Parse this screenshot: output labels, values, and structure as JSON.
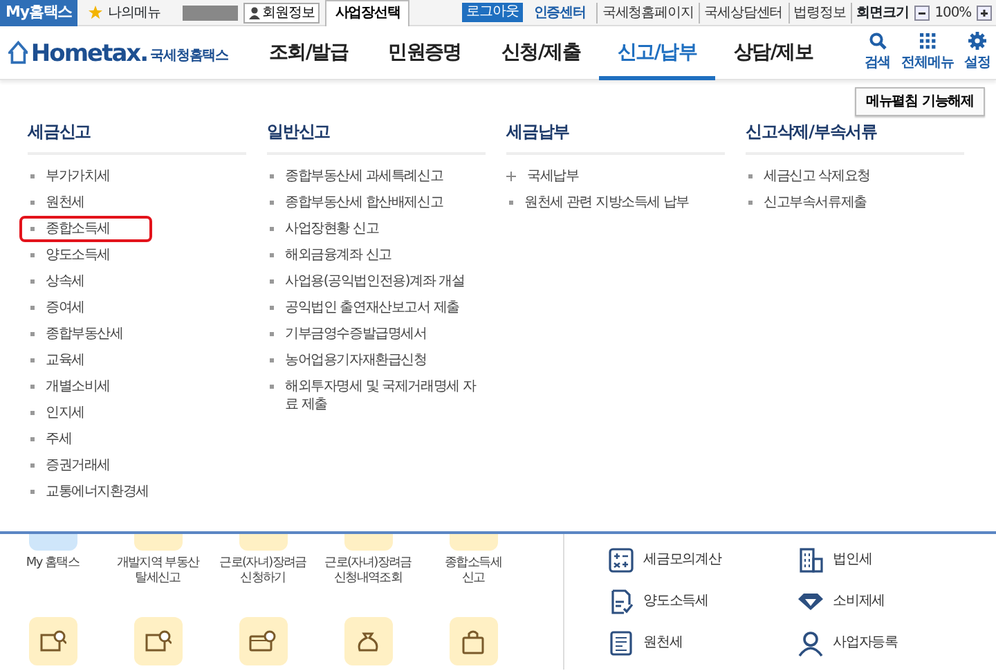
{
  "top_bar": {
    "my_hometax": "My홈택스",
    "my_menu": "나의메뉴",
    "member_info": "회원정보",
    "workplace_select": "사업장선택",
    "logout": "로그아웃",
    "cert_center": "인증센터",
    "links": [
      "국세청홈페이지",
      "국세상담센터",
      "법령정보"
    ],
    "screen_size": "회면크기",
    "zoom": "100%"
  },
  "header": {
    "logo_text": "Hometax.",
    "logo_caption": "국세청홈택스",
    "tabs": [
      {
        "label": "조회/발급",
        "selected": false
      },
      {
        "label": "민원증명",
        "selected": false
      },
      {
        "label": "신청/제출",
        "selected": false
      },
      {
        "label": "신고/납부",
        "selected": true
      },
      {
        "label": "상담/제보",
        "selected": false
      }
    ],
    "tools": [
      {
        "label": "검색",
        "kind": "search"
      },
      {
        "label": "전체메뉴",
        "kind": "grid"
      },
      {
        "label": "설정",
        "kind": "gear"
      }
    ]
  },
  "menu_panel": {
    "toggle_button": "메뉴펼침 기능해제",
    "columns": [
      {
        "title": "세금신고",
        "items": [
          {
            "label": "부가가치세",
            "kind": "dot",
            "highlighted": false
          },
          {
            "label": "원천세",
            "kind": "dot",
            "highlighted": false
          },
          {
            "label": "종합소득세",
            "kind": "dot",
            "highlighted": true
          },
          {
            "label": "양도소득세",
            "kind": "dot",
            "highlighted": false
          },
          {
            "label": "상속세",
            "kind": "dot",
            "highlighted": false
          },
          {
            "label": "증여세",
            "kind": "dot",
            "highlighted": false
          },
          {
            "label": "종합부동산세",
            "kind": "dot",
            "highlighted": false
          },
          {
            "label": "교육세",
            "kind": "dot",
            "highlighted": false
          },
          {
            "label": "개별소비세",
            "kind": "dot",
            "highlighted": false
          },
          {
            "label": "인지세",
            "kind": "dot",
            "highlighted": false
          },
          {
            "label": "주세",
            "kind": "dot",
            "highlighted": false
          },
          {
            "label": "증권거래세",
            "kind": "dot",
            "highlighted": false
          },
          {
            "label": "교통에너지환경세",
            "kind": "dot",
            "highlighted": false
          }
        ]
      },
      {
        "title": "일반신고",
        "items": [
          {
            "label": "종합부동산세 과세특례신고",
            "kind": "dot",
            "highlighted": false
          },
          {
            "label": "종합부동산세 합산배제신고",
            "kind": "dot",
            "highlighted": false
          },
          {
            "label": "사업장현황 신고",
            "kind": "dot",
            "highlighted": false
          },
          {
            "label": "해외금융계좌 신고",
            "kind": "dot",
            "highlighted": false
          },
          {
            "label": "사업용(공익법인전용)계좌 개설",
            "kind": "dot",
            "highlighted": false
          },
          {
            "label": "공익법인 출연재산보고서 제출",
            "kind": "dot",
            "highlighted": false
          },
          {
            "label": "기부금영수증발급명세서",
            "kind": "dot",
            "highlighted": false
          },
          {
            "label": "농어업용기자재환급신청",
            "kind": "dot",
            "highlighted": false
          },
          {
            "label": "해외투자명세 및 국제거래명세 자료 제출",
            "kind": "dot",
            "highlighted": false
          }
        ]
      },
      {
        "title": "세금납부",
        "items": [
          {
            "label": "국세납부",
            "kind": "plus",
            "highlighted": false
          },
          {
            "label": "원천세 관련 지방소득세 납부",
            "kind": "dot",
            "highlighted": false
          }
        ]
      },
      {
        "title": "신고삭제/부속서류",
        "items": [
          {
            "label": "세금신고 삭제요청",
            "kind": "dot",
            "highlighted": false
          },
          {
            "label": "신고부속서류제출",
            "kind": "dot",
            "highlighted": false
          }
        ]
      }
    ]
  },
  "quick_tiles": [
    {
      "label": "My 홈택스",
      "color": "#cfe6fa"
    },
    {
      "label": "개발지역 부동산\n탈세신고",
      "color": "#fff0c4"
    },
    {
      "label": "근로(자녀)장려금\n신청하기",
      "color": "#fff0c4"
    },
    {
      "label": "근로(자녀)장려금\n신청내역조회",
      "color": "#fff0c4"
    },
    {
      "label": "종합소득세\n신고",
      "color": "#fff0c4"
    }
  ],
  "quick_tiles_row_2": [
    {
      "kind": "search-doc",
      "color": "#fff0c4"
    },
    {
      "kind": "search-doc",
      "color": "#fff0c4"
    },
    {
      "kind": "card",
      "color": "#fff0c4"
    },
    {
      "kind": "bag",
      "color": "#fff0c4"
    },
    {
      "kind": "shopping-bag",
      "color": "#fff0c4"
    }
  ],
  "services": [
    {
      "label": "세금모의계산",
      "kind": "calculator"
    },
    {
      "label": "법인세",
      "kind": "building"
    },
    {
      "label": "양도소득세",
      "kind": "document"
    },
    {
      "label": "소비제세",
      "kind": "diamond"
    },
    {
      "label": "원천세",
      "kind": "ledger"
    },
    {
      "label": "사업자등록",
      "kind": "person"
    }
  ]
}
